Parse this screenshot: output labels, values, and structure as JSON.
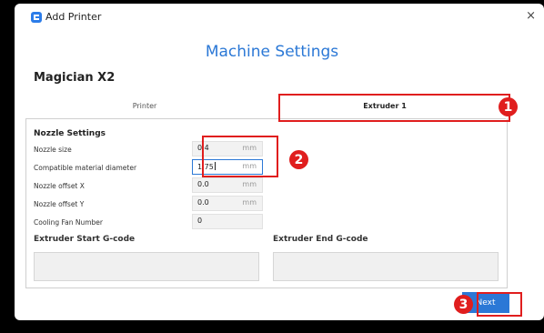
{
  "window": {
    "title": "Add Printer",
    "close_icon": "×"
  },
  "heading": "Machine Settings",
  "printer_model": "Magician X2",
  "tabs": [
    {
      "label": "Printer",
      "selected": false
    },
    {
      "label": "Extruder 1",
      "selected": true
    }
  ],
  "nozzle_settings": {
    "title": "Nozzle Settings",
    "fields": [
      {
        "label": "Nozzle size",
        "value": "0.4",
        "unit": "mm"
      },
      {
        "label": "Compatible material diameter",
        "value": "1.75",
        "unit": "mm"
      },
      {
        "label": "Nozzle offset X",
        "value": "0.0",
        "unit": "mm"
      },
      {
        "label": "Nozzle offset Y",
        "value": "0.0",
        "unit": "mm"
      },
      {
        "label": "Cooling Fan Number",
        "value": "0",
        "unit": ""
      }
    ]
  },
  "gcode": {
    "start_label": "Extruder Start G-code",
    "end_label": "Extruder End G-code"
  },
  "next_label": "Next",
  "annotations": {
    "badge1": "1",
    "badge2": "2",
    "badge3": "3"
  },
  "colors": {
    "accent": "#2b78d6",
    "annotation": "#e01e1e",
    "backdrop": "#000000"
  }
}
